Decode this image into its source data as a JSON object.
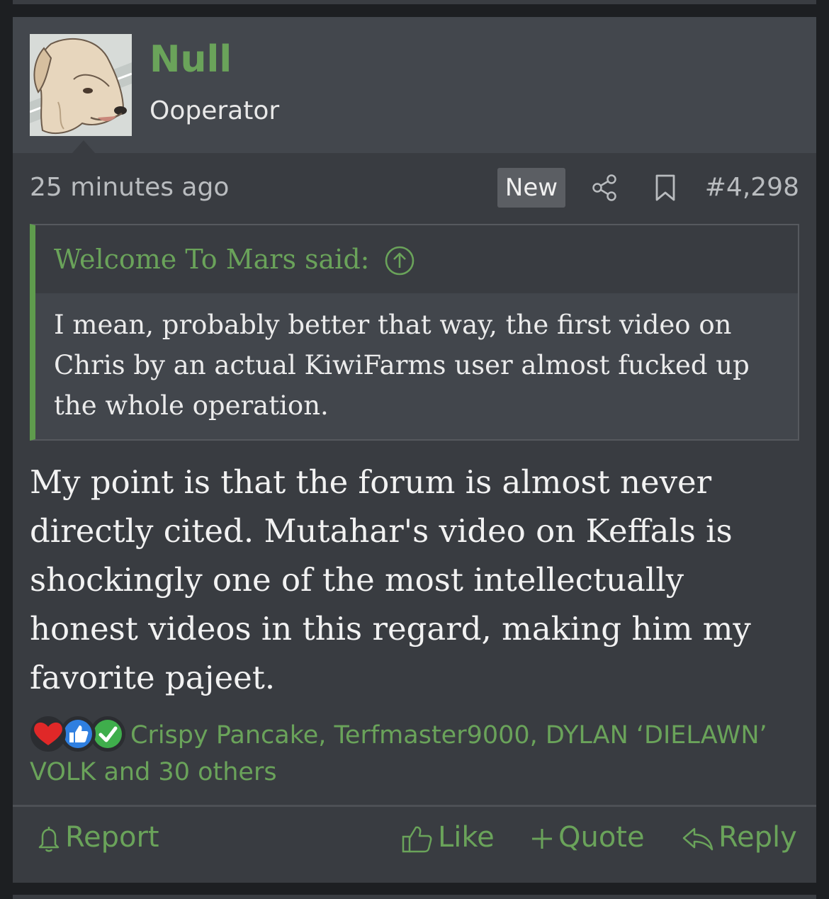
{
  "user": {
    "name": "Null",
    "title": "Ooperator"
  },
  "post": {
    "time": "25 minutes ago",
    "badge": "New",
    "number": "#4,298",
    "message": "My point is that the forum is almost never directly cited. Mutahar's video on Keffals is shockingly one of the most intellectually honest videos in this regard, making him my favorite pajeet."
  },
  "quote": {
    "author": "Welcome To Mars said:",
    "text": "I mean, probably better that way, the first video on Chris by an actual KiwiFarms user almost fucked up the whole operation."
  },
  "reactions": {
    "summary": "Crispy Pancake, Terfmaster9000, DYLAN ‘DIELAWN’ VOLK and 30 others",
    "icons": [
      "heart-icon",
      "thumbs-up-icon",
      "check-icon"
    ]
  },
  "actions": {
    "report": "Report",
    "like": "Like",
    "quote": "Quote",
    "reply": "Reply"
  },
  "colors": {
    "accent": "#6aa35a",
    "background": "#393c41",
    "header": "#43474d"
  }
}
